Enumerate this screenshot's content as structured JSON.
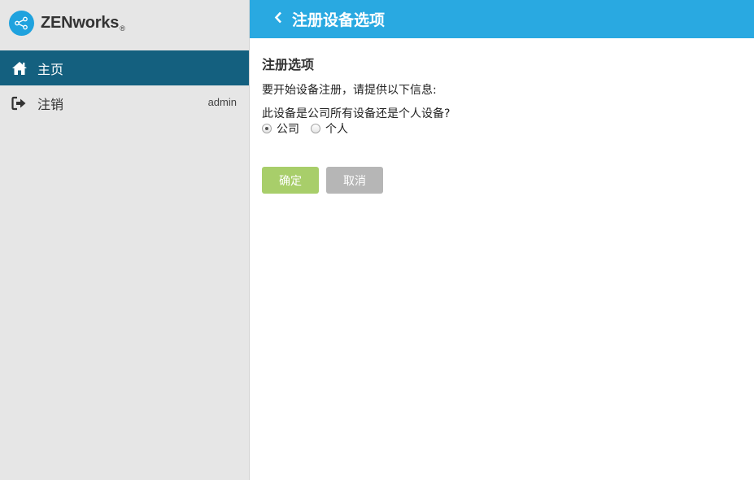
{
  "brand": {
    "name": "ZENworks",
    "registered": "®"
  },
  "sidebar": {
    "items": [
      {
        "label": "主页",
        "icon": "home-icon"
      },
      {
        "label": "注销",
        "icon": "logout-icon",
        "user": "admin"
      }
    ]
  },
  "header": {
    "title": "注册设备选项",
    "back_icon": "chevron-left-icon"
  },
  "main": {
    "section_title": "注册选项",
    "intro": "要开始设备注册，请提供以下信息:",
    "question": "此设备是公司所有设备还是个人设备?",
    "options": [
      {
        "label": "公司",
        "selected": true
      },
      {
        "label": "个人",
        "selected": false
      }
    ],
    "ok_label": "确定",
    "cancel_label": "取消"
  },
  "colors": {
    "header": "#29a9e1",
    "nav_active": "#14607f",
    "sidebar": "#e6e6e6",
    "ok_button": "#a8ce6a",
    "cancel_button": "#b6b6b6",
    "logo": "#1fa2de"
  }
}
